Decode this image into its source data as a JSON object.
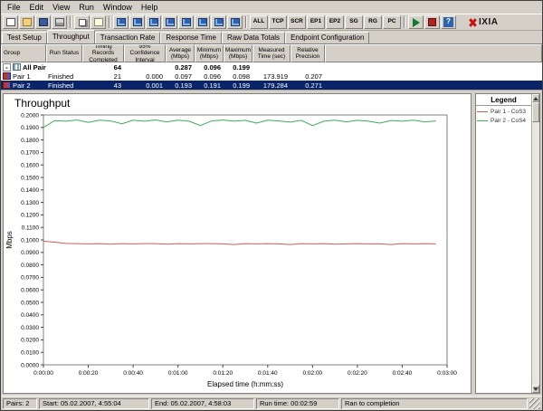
{
  "menu": {
    "items": [
      "File",
      "Edit",
      "View",
      "Run",
      "Window",
      "Help"
    ]
  },
  "toolbar": {
    "icon_groups": [
      {
        "icons": [
          {
            "name": "new-test-icon",
            "style": "doc"
          },
          {
            "name": "open-test-icon",
            "style": "folder"
          },
          {
            "name": "save-test-icon",
            "style": "save"
          },
          {
            "name": "print-icon",
            "style": "print"
          }
        ]
      },
      {
        "icons": [
          {
            "name": "copy-test-icon",
            "style": "doc2"
          },
          {
            "name": "message-log-icon",
            "style": "mail"
          }
        ]
      },
      {
        "icons": [
          {
            "name": "add-pair-icon",
            "style": "blue"
          },
          {
            "name": "edit-pair-icon",
            "style": "blue"
          },
          {
            "name": "replicate-pair-icon",
            "style": "blue"
          },
          {
            "name": "swap-endpoints-icon",
            "style": "blue"
          },
          {
            "name": "add-multicast-group-icon",
            "style": "blue"
          },
          {
            "name": "edit-multicast-group-icon",
            "style": "blue"
          },
          {
            "name": "connect-endpoints-icon",
            "style": "blue"
          },
          {
            "name": "disconnect-endpoints-icon",
            "style": "blue"
          }
        ]
      }
    ],
    "view_buttons": [
      "ALL",
      "TCP",
      "SCR",
      "EP1",
      "EP2",
      "SG",
      "RG",
      "PC"
    ],
    "right_icon_groups": [
      {
        "icons": [
          {
            "name": "run-test-icon",
            "style": "run"
          },
          {
            "name": "stop-test-icon",
            "style": "stop"
          },
          {
            "name": "help-icon",
            "style": "help",
            "glyph": "?"
          }
        ]
      }
    ],
    "logo_text": "IXIA"
  },
  "tabs": {
    "items": [
      "Test Setup",
      "Throughput",
      "Transaction Rate",
      "Response Time",
      "Raw Data Totals",
      "Endpoint Configuration"
    ],
    "active_index": 1
  },
  "table": {
    "headers": [
      {
        "label": "Group"
      },
      {
        "label": "Run Status"
      },
      {
        "label": "Timing Records\nCompleted"
      },
      {
        "label": "95% Confidence\nInterval"
      },
      {
        "label": "Average\n(Mbps)"
      },
      {
        "label": "Minimum\n(Mbps)"
      },
      {
        "label": "Maximum\n(Mbps)"
      },
      {
        "label": "Measured\nTime (sec)"
      },
      {
        "label": "Relative\nPrecision"
      }
    ],
    "rows": [
      {
        "type": "group",
        "label": "All Pairs",
        "selected": false,
        "cells": [
          "",
          "64",
          "",
          "0.287",
          "0.096",
          "0.199",
          "",
          ""
        ]
      },
      {
        "type": "pair",
        "label": "Pair 1",
        "selected": false,
        "cells": [
          "Finished",
          "21",
          "0.000",
          "0.097",
          "0.096",
          "0.098",
          "173.919",
          "0.207"
        ]
      },
      {
        "type": "pair",
        "label": "Pair 2",
        "selected": true,
        "cells": [
          "Finished",
          "43",
          "0.001",
          "0.193",
          "0.191",
          "0.199",
          "179.284",
          "0.271"
        ]
      }
    ]
  },
  "chart_data": {
    "type": "line",
    "title": "Throughput",
    "xlabel": "Elapsed time (h:mm:ss)",
    "ylabel": "Mbps",
    "ylim": [
      0,
      0.2
    ],
    "ytick_step": 0.01,
    "xlim_seconds": [
      0,
      180
    ],
    "xtick_step_seconds": 20,
    "xtick_labels": [
      "0:00:00",
      "0:00:20",
      "0:00:40",
      "0:01:00",
      "0:01:20",
      "0:01:40",
      "0:02:00",
      "0:02:20",
      "0:02:40",
      "0:03:00"
    ],
    "grid": false,
    "legend_position": "right-panel",
    "series": [
      {
        "name": "Pair 1 - CoS3",
        "color": "#cc5c5c",
        "x_seconds": [
          0,
          5,
          10,
          15,
          20,
          25,
          30,
          35,
          40,
          45,
          50,
          55,
          60,
          65,
          70,
          75,
          80,
          85,
          90,
          95,
          100,
          105,
          110,
          115,
          120,
          125,
          130,
          135,
          140,
          145,
          150,
          155,
          160,
          165,
          170,
          175
        ],
        "values": [
          0.099,
          0.0982,
          0.0972,
          0.097,
          0.0968,
          0.097,
          0.0965,
          0.097,
          0.0968,
          0.097,
          0.097,
          0.0965,
          0.097,
          0.0968,
          0.097,
          0.097,
          0.0968,
          0.0963,
          0.097,
          0.0968,
          0.097,
          0.0968,
          0.0963,
          0.097,
          0.0968,
          0.097,
          0.0965,
          0.0968,
          0.097,
          0.0968,
          0.0968,
          0.0963,
          0.097,
          0.0968,
          0.097,
          0.0968
        ]
      },
      {
        "name": "Pair 2 - CoS4",
        "color": "#3cae58",
        "x_seconds": [
          0,
          5,
          10,
          15,
          20,
          25,
          30,
          35,
          40,
          45,
          50,
          55,
          60,
          65,
          70,
          75,
          80,
          85,
          90,
          95,
          100,
          105,
          110,
          115,
          120,
          125,
          130,
          135,
          140,
          145,
          150,
          155,
          160,
          165,
          170,
          175
        ],
        "values": [
          0.19,
          0.1955,
          0.195,
          0.196,
          0.194,
          0.1958,
          0.1952,
          0.193,
          0.1958,
          0.195,
          0.196,
          0.1945,
          0.1958,
          0.195,
          0.1915,
          0.1952,
          0.196,
          0.195,
          0.1957,
          0.1935,
          0.1958,
          0.1952,
          0.1943,
          0.1957,
          0.1915,
          0.195,
          0.1958,
          0.1945,
          0.1957,
          0.195,
          0.1935,
          0.1956,
          0.195,
          0.1958,
          0.1945,
          0.1952
        ]
      }
    ]
  },
  "legend": {
    "title": "Legend",
    "entries": [
      {
        "label": "Pair 1 - CoS3",
        "color": "#cc5c5c"
      },
      {
        "label": "Pair 2 - CoS4",
        "color": "#3cae58"
      }
    ]
  },
  "status_bar": {
    "items": [
      {
        "name": "pairs-count",
        "text": "Pairs: 2"
      },
      {
        "name": "start-time",
        "text": "Start: 05.02.2007, 4:55:04"
      },
      {
        "name": "end-time",
        "text": "End: 05.02.2007, 4:58:03"
      },
      {
        "name": "run-time",
        "text": "Run time: 00:02:59"
      },
      {
        "name": "completion-status",
        "text": "Ran to completion"
      }
    ]
  }
}
